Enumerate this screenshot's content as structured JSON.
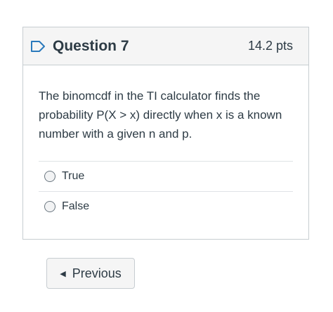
{
  "question": {
    "title": "Question 7",
    "points": "14.2 pts",
    "flag_icon": "flag-outline-icon",
    "text": "The binomcdf in the TI calculator finds the probability P(X > x) directly when x is a known number with a given n and p.",
    "answers": [
      {
        "label": "True"
      },
      {
        "label": "False"
      }
    ]
  },
  "navigation": {
    "previous_label": "Previous",
    "previous_icon": "caret-left-icon"
  },
  "colors": {
    "flag": "#2b7abc",
    "text": "#2d3b45",
    "border": "#c7cdd1"
  }
}
